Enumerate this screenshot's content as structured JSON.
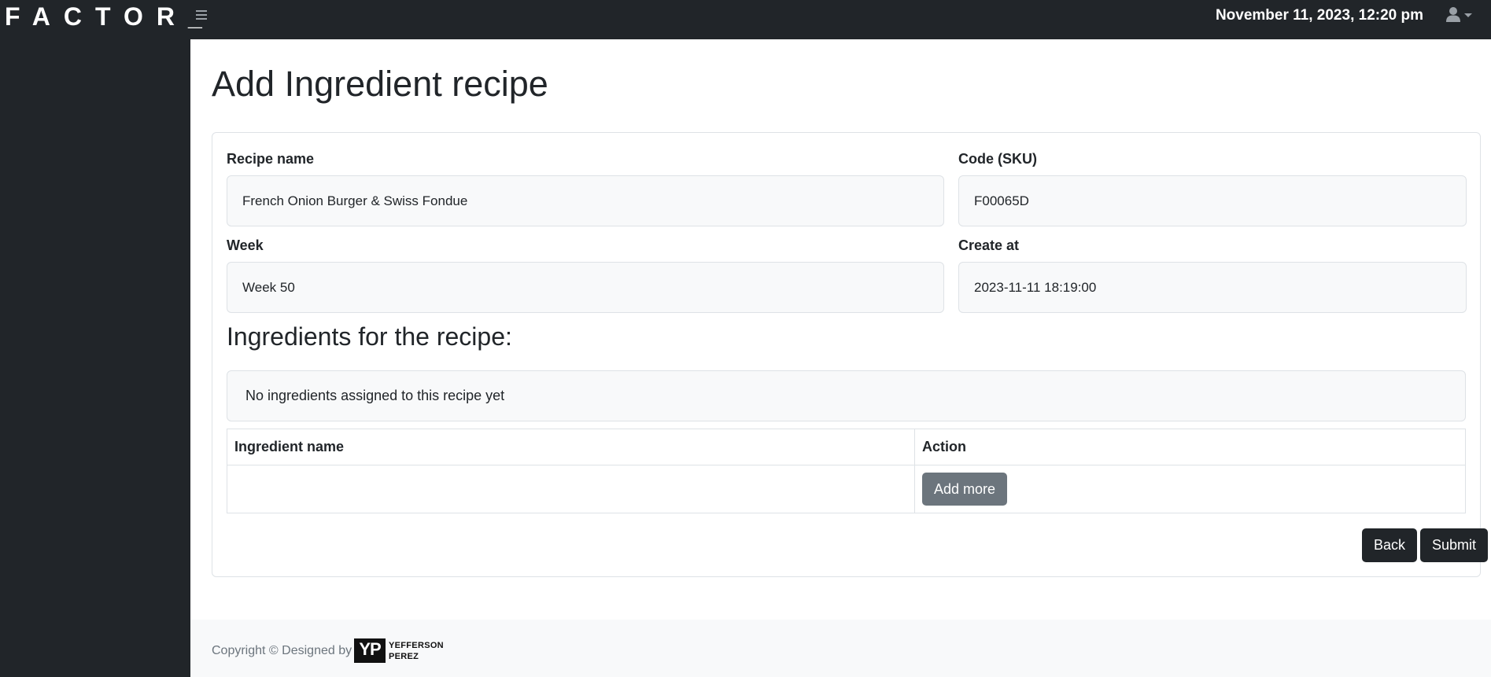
{
  "header": {
    "brand": "FACTOR_",
    "datetime": "November 11, 2023, 12:20 pm"
  },
  "page": {
    "title": "Add Ingredient recipe"
  },
  "form": {
    "recipe_name_label": "Recipe name",
    "recipe_name_value": "French Onion Burger & Swiss Fondue",
    "code_label": "Code (SKU)",
    "code_value": "F00065D",
    "week_label": "Week",
    "week_value": "Week 50",
    "created_label": "Create at",
    "created_value": "2023-11-11 18:19:00"
  },
  "ingredients": {
    "title": "Ingredients for the recipe:",
    "empty_message": "No ingredients assigned to this recipe yet",
    "columns": [
      "Ingredient name",
      "Action"
    ],
    "add_more_label": "Add more"
  },
  "actions": {
    "back_label": "Back",
    "submit_label": "Submit"
  },
  "footer": {
    "text": "Copyright © Designed by",
    "logo_mark": "YP",
    "logo_line1": "YEFFERSON",
    "logo_line2": "PEREZ"
  },
  "colors": {
    "dark": "#212529",
    "secondary": "#6c757d",
    "light": "#f8f9fa"
  },
  "icons": {
    "menu": "hamburger-icon",
    "user": "user-icon",
    "dropdown": "caret-down-icon"
  }
}
